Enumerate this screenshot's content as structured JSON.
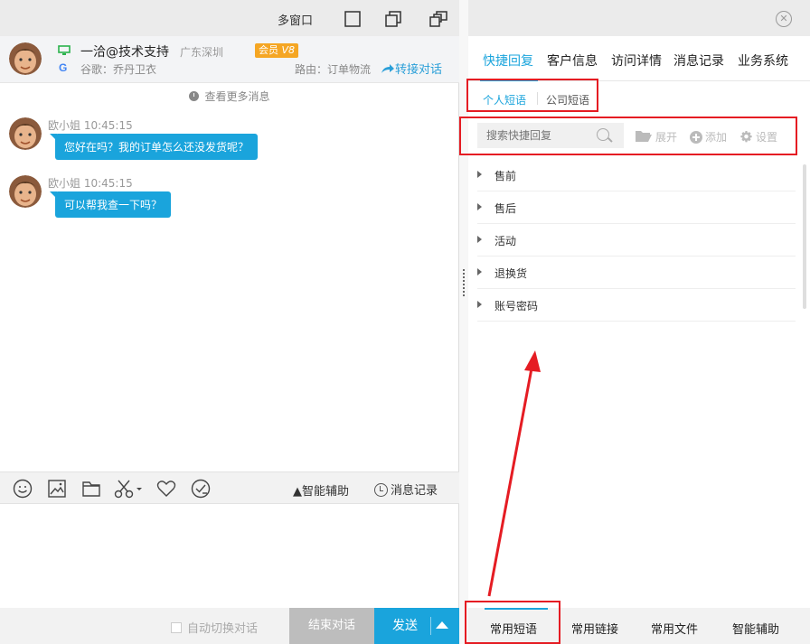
{
  "left": {
    "topbar": {
      "multi_window": "多窗口"
    },
    "customer": {
      "name": "一洽@技术支持",
      "location": "广东深圳",
      "vip_label": "会员",
      "vip_level": "V8",
      "source_icon": "G",
      "source": "谷歌：乔丹卫衣",
      "route": "路由：订单物流",
      "transfer": "转接对话"
    },
    "history_link": "查看更多消息",
    "messages": [
      {
        "sender": "欧小姐",
        "time": "10:45:15",
        "text": "您好在吗？我的订单怎么还没发货呢？"
      },
      {
        "sender": "欧小姐",
        "time": "10:45:15",
        "text": "可以帮我查一下吗？"
      }
    ],
    "toolbar": {
      "assist": "智能辅助",
      "record": "消息记录"
    },
    "bottom": {
      "auto_switch": "自动切换对话",
      "end_chat": "结束对话",
      "send": "发送"
    }
  },
  "right": {
    "tabs": [
      "快捷回复",
      "客户信息",
      "访问详情",
      "消息记录",
      "业务系统"
    ],
    "active_tab": 0,
    "subtabs": [
      "个人短语",
      "公司短语"
    ],
    "search_placeholder": "搜索快捷回复",
    "actions": {
      "expand": "展开",
      "add": "添加",
      "settings": "设置"
    },
    "categories": [
      "售前",
      "售后",
      "活动",
      "退换货",
      "账号密码"
    ],
    "bottom_nav": [
      "常用短语",
      "常用链接",
      "常用文件",
      "智能辅助"
    ]
  },
  "colors": {
    "accent": "#1aa4dc",
    "annotation": "#e51c23",
    "vip": "#f5a623"
  },
  "icons": [
    "monitor-icon",
    "google-icon",
    "transfer-arrow-icon",
    "clock-icon",
    "emoji-icon",
    "image-icon",
    "folder-icon",
    "scissors-icon",
    "heart-icon",
    "check-circle-icon",
    "close-icon",
    "search-icon",
    "settings-icon"
  ]
}
